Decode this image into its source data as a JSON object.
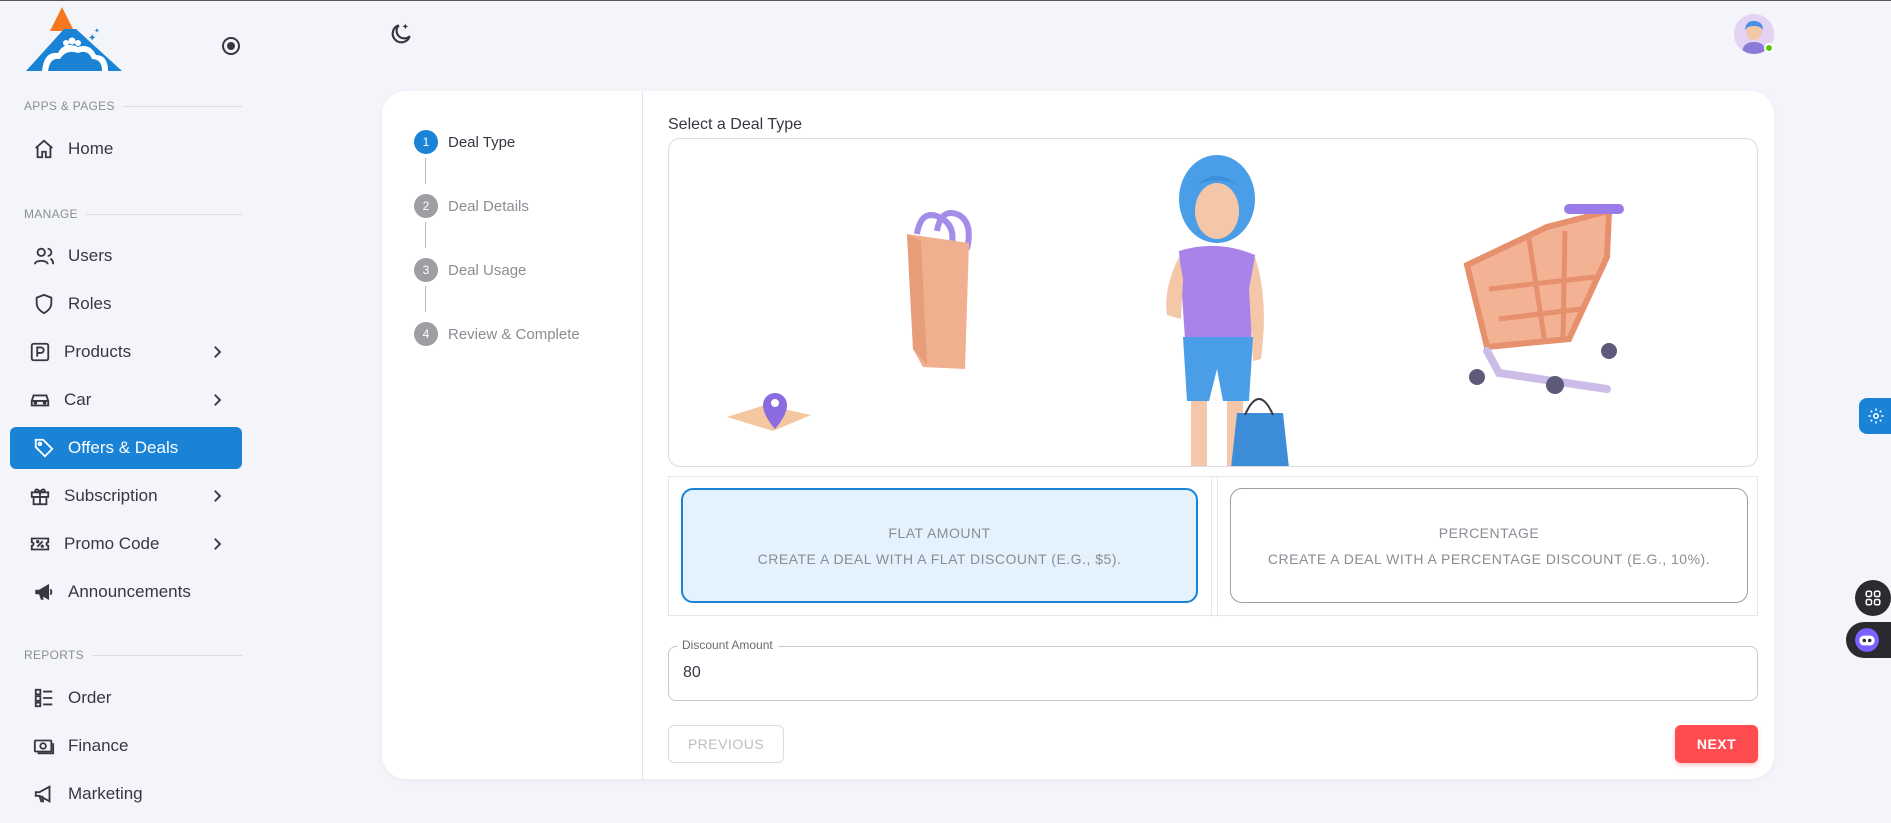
{
  "sidebar": {
    "sections": {
      "apps": "APPS & PAGES",
      "manage": "MANAGE",
      "reports": "REPORTS"
    },
    "items": {
      "home": "Home",
      "users": "Users",
      "roles": "Roles",
      "products": "Products",
      "car": "Car",
      "offers": "Offers & Deals",
      "subscription": "Subscription",
      "promo": "Promo Code",
      "announcements": "Announcements",
      "order": "Order",
      "finance": "Finance",
      "marketing": "Marketing"
    },
    "active_item": "Offers & Deals",
    "accent_color": "#1a83d6"
  },
  "stepper": {
    "steps": [
      {
        "num": "1",
        "label": "Deal Type"
      },
      {
        "num": "2",
        "label": "Deal Details"
      },
      {
        "num": "3",
        "label": "Deal Usage"
      },
      {
        "num": "4",
        "label": "Review & Complete"
      }
    ],
    "active_step": 1
  },
  "content": {
    "title": "Select a Deal Type",
    "options": {
      "flat": {
        "title": "FLAT AMOUNT",
        "desc": "CREATE A DEAL WITH A FLAT DISCOUNT (E.G., $5)."
      },
      "percentage": {
        "title": "PERCENTAGE",
        "desc": "CREATE A DEAL WITH A PERCENTAGE DISCOUNT (E.G., 10%)."
      }
    },
    "selected_option": "flat",
    "discount_field": {
      "label": "Discount Amount",
      "value": "80"
    },
    "buttons": {
      "previous": "PREVIOUS",
      "next": "NEXT"
    }
  },
  "icons": {
    "theme": "moon-stars-icon",
    "avatar": "user-avatar",
    "settings": "gear-icon",
    "grid": "grid-icon",
    "bot": "chatbot-icon"
  },
  "colors": {
    "primary": "#1a83d6",
    "danger": "#ff4c51",
    "selected_bg": "#e3f2fd"
  }
}
